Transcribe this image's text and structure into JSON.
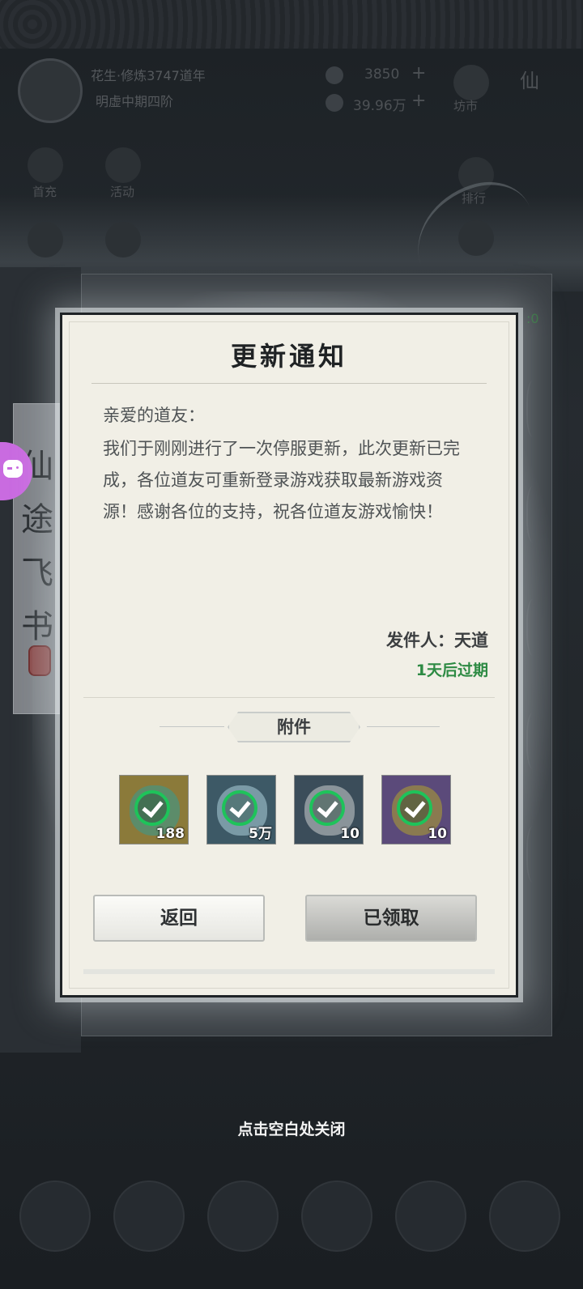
{
  "hud": {
    "player_name": "花生·修炼3747道年",
    "realm": "明虚中期四阶",
    "currency1": "3850",
    "currency2": "39.96万",
    "plus": "+",
    "market_label": "坊市",
    "xian_label": "仙",
    "left_icons": [
      "首充",
      "活动"
    ],
    "right_icons": [
      "排行"
    ]
  },
  "side_scroll": {
    "chars": [
      "仙",
      "途",
      "飞",
      "书"
    ]
  },
  "modal": {
    "title": "更新通知",
    "greeting": "亲爱的道友：",
    "body": "我们于刚刚进行了一次停服更新，此次更新已完成，各位道友可重新登录游戏获取最新游戏资源！感谢各位的支持，祝各位道友游戏愉快！",
    "sender": "发件人：天道",
    "expire": "1天后过期",
    "attachment_label": "附件",
    "items": [
      {
        "count": "188",
        "bg": "#8b7a3a",
        "art": "#5c8c6a",
        "icon": "jade-ore-icon"
      },
      {
        "count": "5万",
        "bg": "#3d5966",
        "art": "#7a9aa6",
        "icon": "spirit-stone-icon"
      },
      {
        "count": "10",
        "bg": "#3b4d5a",
        "art": "#8a949a",
        "icon": "scroll-icon"
      },
      {
        "count": "10",
        "bg": "#5b4a7a",
        "art": "#8a7a50",
        "icon": "book-icon"
      }
    ],
    "back_button": "返回",
    "claimed_button": "已领取"
  },
  "hint": "点击空白处关闭",
  "colors": {
    "claim_check": "#1ec35a",
    "expire_text": "#2d8a43",
    "controller": "#c96be0"
  }
}
